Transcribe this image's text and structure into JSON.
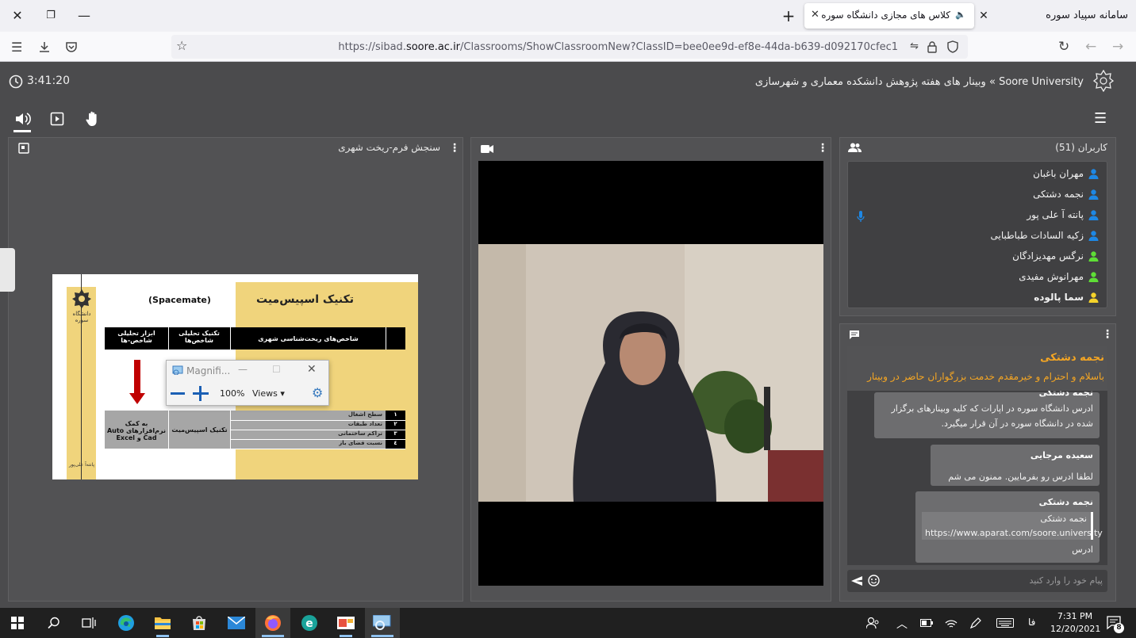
{
  "browser": {
    "window_title": "سامانه سپیاد سوره",
    "tab_title": "کلاس های مجازی دانشگاه سوره",
    "url_prefix": "https://sibad.",
    "url_domain": "soore.ac.ir",
    "url_path": "/Classrooms/ShowClassroomNew?ClassID=bee0ee9d-ef8e-44da-b639-d092170cfec1"
  },
  "header": {
    "timer": "3:41:20",
    "breadcrumb": "Soore University » وبینار های هفته پژوهش دانشکده معماری و شهرسازی"
  },
  "presentation": {
    "title": "سنجش فرم-ریخت شهری",
    "slide": {
      "heading": "تکنیک اسپیس‌میت",
      "heading_en": "(Spacemate)",
      "col1": "شاخص‌های ریخت‌شناسی شهری",
      "col2": "تکنیک تحلیلی شاخص‌ها",
      "col3": "ابزار تحلیلی شاخص-ها",
      "technique": "تکنیک اسپیس‌میت",
      "tool": "به کمک نرم‌افزارهای Auto Cad و Excel",
      "rows": [
        {
          "num": "۱",
          "label": "سطح اشغال"
        },
        {
          "num": "۲",
          "label": "تعداد طبقات"
        },
        {
          "num": "۳",
          "label": "تراکم ساختمانی"
        },
        {
          "num": "٤",
          "label": "نسبت فضای باز"
        }
      ],
      "logo_text": "دانشگاه سوره",
      "author": "پانته‌آ علی‌پور"
    }
  },
  "magnifier": {
    "title": "Magnifi...",
    "zoom": "100%",
    "views": "Views"
  },
  "users": {
    "title": "کاربران (51)",
    "list": [
      {
        "name": "مهران باغبان",
        "color": "#1e88e5"
      },
      {
        "name": "نجمه دشتکی",
        "color": "#1e88e5"
      },
      {
        "name": "پانته آ علی پور",
        "color": "#1e88e5"
      },
      {
        "name": "زکیه السادات طباطبایی",
        "color": "#1e88e5"
      },
      {
        "name": "نرگس مهدیزادگان",
        "color": "#5ede36"
      },
      {
        "name": "مهرانوش مفیدی",
        "color": "#5ede36"
      },
      {
        "name": "سما پالوده",
        "color": "#f5d32a"
      }
    ]
  },
  "chat": {
    "pinned_name": "نجمه دشتکی",
    "pinned_text": "باسلام و احترام و خیرمقدم خدمت بزرگواران حاضر در وبینار",
    "messages": [
      {
        "name": "نجمه دشتکی",
        "text": "ادرس دانشگاه سوره در اپارات که کلیه وبینارهای برگزار شده در دانشگاه سوره در آن قرار میگیرد."
      },
      {
        "name": "سعیده مرجایی",
        "text": "لطفا ادرس رو بفرمایین. ممنون می شم"
      },
      {
        "name": "نجمه دشتکی",
        "quote_name": "نجمه دشتکی",
        "quote_text": "https://www.aparat.com/soore.university",
        "text": "ادرس"
      }
    ],
    "input_placeholder": "پیام خود را وارد کنید"
  },
  "taskbar": {
    "lang": "فا",
    "time": "7:31 PM",
    "date": "12/20/2021",
    "notif_count": "8"
  }
}
